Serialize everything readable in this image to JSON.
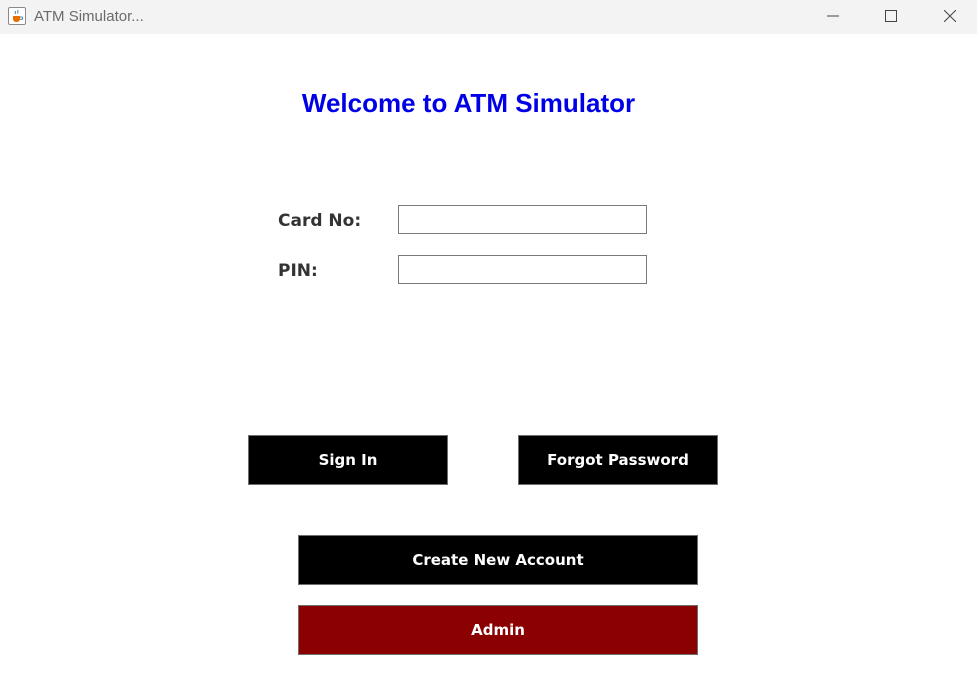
{
  "window": {
    "title": "ATM Simulator...",
    "icon": "java-cup-icon",
    "controls": [
      "minimize-icon",
      "maximize-icon",
      "close-icon"
    ]
  },
  "form": {
    "heading": "Welcome to ATM Simulator",
    "card_label": "Card No:",
    "card_value": "",
    "pin_label": "PIN:",
    "pin_value": ""
  },
  "buttons": {
    "sign_in": "Sign In",
    "forgot_password": "Forgot Password",
    "create_account": "Create New Account",
    "admin": "Admin"
  },
  "colors": {
    "heading": "#0000e6",
    "button_bg": "#000000",
    "admin_bg": "#8b0000",
    "button_text": "#ffffff"
  }
}
